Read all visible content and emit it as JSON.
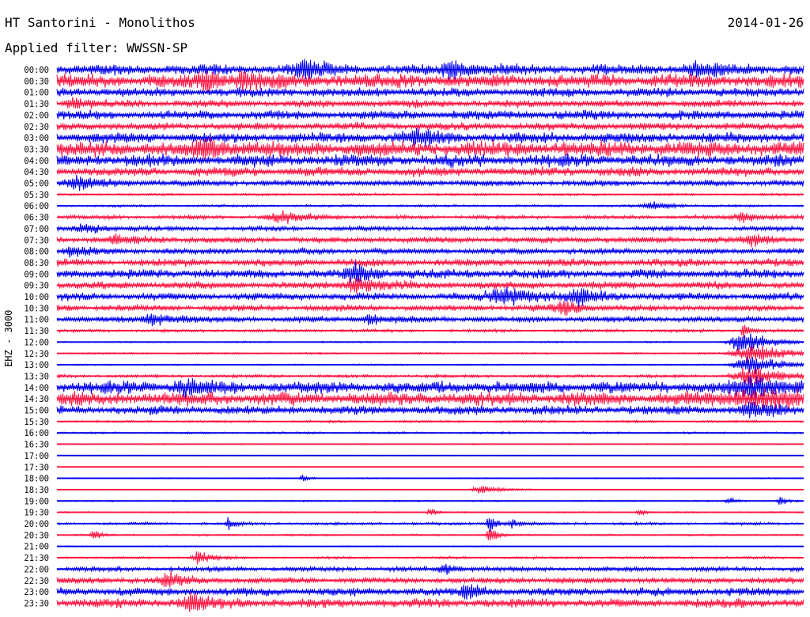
{
  "header": {
    "title": "HT Santorini - Monolithos",
    "date": "2014-01-26",
    "filter": "Applied filter: WWSSN-SP"
  },
  "channel_label": "EHZ - 3000",
  "chart_data": {
    "type": "helicorder",
    "title": "HT Santorini - Monolithos",
    "date": "2014-01-26",
    "filter": "WWSSN-SP",
    "channel": "EHZ - 3000",
    "row_duration_minutes": 30,
    "colors": [
      "#0000ee",
      "#ff1744"
    ],
    "rows": [
      {
        "time": "00:00",
        "level": 7,
        "events": [
          {
            "t": 0.33,
            "w": 0.03,
            "amp": 12
          },
          {
            "t": 0.53,
            "w": 0.03,
            "amp": 12
          },
          {
            "t": 0.86,
            "w": 0.04,
            "amp": 8
          }
        ]
      },
      {
        "time": "00:30",
        "level": 9,
        "events": [
          {
            "t": 0.2,
            "w": 0.03,
            "amp": 11
          },
          {
            "t": 0.25,
            "w": 0.02,
            "amp": 10
          }
        ]
      },
      {
        "time": "01:00",
        "level": 6,
        "events": []
      },
      {
        "time": "01:30",
        "level": 5,
        "events": [
          {
            "t": 0.02,
            "w": 0.02,
            "amp": 8
          }
        ]
      },
      {
        "time": "02:00",
        "level": 6,
        "events": []
      },
      {
        "time": "02:30",
        "level": 5,
        "events": []
      },
      {
        "time": "03:00",
        "level": 7,
        "events": [
          {
            "t": 0.48,
            "w": 0.03,
            "amp": 10
          }
        ]
      },
      {
        "time": "03:30",
        "level": 10,
        "events": [
          {
            "t": 0.2,
            "w": 0.03,
            "amp": 11
          }
        ]
      },
      {
        "time": "04:00",
        "level": 8,
        "events": []
      },
      {
        "time": "04:30",
        "level": 6,
        "events": []
      },
      {
        "time": "05:00",
        "level": 4,
        "events": [
          {
            "t": 0.03,
            "w": 0.04,
            "amp": 9
          }
        ]
      },
      {
        "time": "05:30",
        "level": 1.5,
        "events": []
      },
      {
        "time": "06:00",
        "level": 1.5,
        "events": [
          {
            "t": 0.8,
            "w": 0.03,
            "amp": 6
          }
        ]
      },
      {
        "time": "06:30",
        "level": 2.5,
        "events": [
          {
            "t": 0.3,
            "w": 0.04,
            "amp": 8
          },
          {
            "t": 0.92,
            "w": 0.03,
            "amp": 7
          }
        ]
      },
      {
        "time": "07:00",
        "level": 3,
        "events": [
          {
            "t": 0.04,
            "w": 0.03,
            "amp": 7
          }
        ]
      },
      {
        "time": "07:30",
        "level": 4,
        "events": [
          {
            "t": 0.08,
            "w": 0.03,
            "amp": 7
          },
          {
            "t": 0.93,
            "w": 0.03,
            "amp": 7
          }
        ]
      },
      {
        "time": "08:00",
        "level": 4,
        "events": [
          {
            "t": 0.02,
            "w": 0.02,
            "amp": 9
          }
        ]
      },
      {
        "time": "08:30",
        "level": 5,
        "events": []
      },
      {
        "time": "09:00",
        "level": 6,
        "events": [
          {
            "t": 0.4,
            "w": 0.03,
            "amp": 11
          }
        ]
      },
      {
        "time": "09:30",
        "level": 5,
        "events": [
          {
            "t": 0.4,
            "w": 0.03,
            "amp": 12
          }
        ]
      },
      {
        "time": "10:00",
        "level": 5,
        "events": [
          {
            "t": 0.6,
            "w": 0.05,
            "amp": 12
          },
          {
            "t": 0.7,
            "w": 0.03,
            "amp": 9
          }
        ]
      },
      {
        "time": "10:30",
        "level": 4,
        "events": [
          {
            "t": 0.68,
            "w": 0.03,
            "amp": 9
          }
        ]
      },
      {
        "time": "11:00",
        "level": 4,
        "events": [
          {
            "t": 0.13,
            "w": 0.03,
            "amp": 9
          },
          {
            "t": 0.42,
            "w": 0.02,
            "amp": 9
          }
        ]
      },
      {
        "time": "11:30",
        "level": 2,
        "events": [
          {
            "t": 0.92,
            "w": 0.01,
            "amp": 10
          }
        ]
      },
      {
        "time": "12:00",
        "level": 1,
        "events": [
          {
            "t": 0.92,
            "w": 0.04,
            "amp": 16
          }
        ]
      },
      {
        "time": "12:30",
        "level": 1.2,
        "events": [
          {
            "t": 0.93,
            "w": 0.05,
            "amp": 15
          }
        ]
      },
      {
        "time": "13:00",
        "level": 1,
        "events": [
          {
            "t": 0.93,
            "w": 0.05,
            "amp": 14
          }
        ]
      },
      {
        "time": "13:30",
        "level": 2,
        "events": [
          {
            "t": 0.93,
            "w": 0.05,
            "amp": 14
          }
        ]
      },
      {
        "time": "14:00",
        "level": 8,
        "events": [
          {
            "t": 0.17,
            "w": 0.03,
            "amp": 12
          },
          {
            "t": 0.93,
            "w": 0.06,
            "amp": 12
          }
        ]
      },
      {
        "time": "14:30",
        "level": 9,
        "events": [
          {
            "t": 0.93,
            "w": 0.06,
            "amp": 13
          }
        ]
      },
      {
        "time": "15:00",
        "level": 6,
        "events": [
          {
            "t": 0.93,
            "w": 0.03,
            "amp": 9
          }
        ]
      },
      {
        "time": "15:30",
        "level": 1.5,
        "events": []
      },
      {
        "time": "16:00",
        "level": 1.3,
        "events": []
      },
      {
        "time": "16:30",
        "level": 0.8,
        "events": []
      },
      {
        "time": "17:00",
        "level": 0.6,
        "events": []
      },
      {
        "time": "17:30",
        "level": 0.6,
        "events": []
      },
      {
        "time": "18:00",
        "level": 0.8,
        "events": [
          {
            "t": 0.33,
            "w": 0.01,
            "amp": 5
          }
        ]
      },
      {
        "time": "18:30",
        "level": 0.7,
        "events": [
          {
            "t": 0.57,
            "w": 0.03,
            "amp": 6
          }
        ]
      },
      {
        "time": "19:00",
        "level": 1,
        "events": [
          {
            "t": 0.9,
            "w": 0.01,
            "amp": 6
          },
          {
            "t": 0.97,
            "w": 0.01,
            "amp": 8
          }
        ]
      },
      {
        "time": "19:30",
        "level": 1,
        "events": [
          {
            "t": 0.5,
            "w": 0.01,
            "amp": 6
          },
          {
            "t": 0.78,
            "w": 0.01,
            "amp": 5
          }
        ]
      },
      {
        "time": "20:00",
        "level": 1.8,
        "events": [
          {
            "t": 0.23,
            "w": 0.01,
            "amp": 8
          },
          {
            "t": 0.58,
            "w": 0.01,
            "amp": 14
          },
          {
            "t": 0.61,
            "w": 0.01,
            "amp": 8
          }
        ]
      },
      {
        "time": "20:30",
        "level": 1.2,
        "events": [
          {
            "t": 0.05,
            "w": 0.01,
            "amp": 8
          },
          {
            "t": 0.58,
            "w": 0.01,
            "amp": 12
          }
        ]
      },
      {
        "time": "21:00",
        "level": 0.8,
        "events": []
      },
      {
        "time": "21:30",
        "level": 1.6,
        "events": [
          {
            "t": 0.19,
            "w": 0.02,
            "amp": 10
          }
        ]
      },
      {
        "time": "22:00",
        "level": 3,
        "events": [
          {
            "t": 0.52,
            "w": 0.02,
            "amp": 8
          }
        ]
      },
      {
        "time": "22:30",
        "level": 4,
        "events": [
          {
            "t": 0.15,
            "w": 0.03,
            "amp": 9
          }
        ]
      },
      {
        "time": "23:00",
        "level": 5.5,
        "events": [
          {
            "t": 0.55,
            "w": 0.02,
            "amp": 10
          }
        ]
      },
      {
        "time": "23:30",
        "level": 6,
        "events": [
          {
            "t": 0.18,
            "w": 0.03,
            "amp": 11
          }
        ]
      }
    ]
  }
}
